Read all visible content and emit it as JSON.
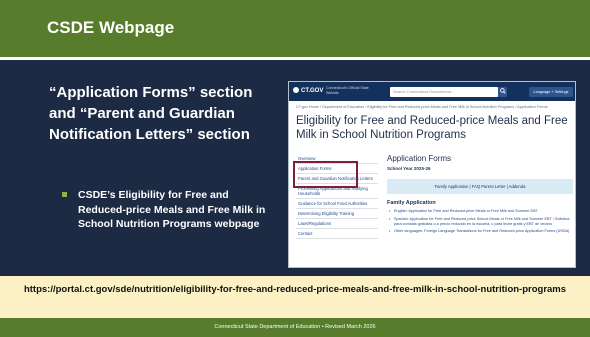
{
  "slide": {
    "title": "CSDE Webpage",
    "heading": "“Application Forms” section and “Parent and Guardian Notification Letters” section",
    "bullet": "CSDE’s Eligibility for Free and Reduced-price Meals and Free Milk in School Nutrition Programs webpage",
    "url": "https://portal.ct.gov/sde/nutrition/eligibility-for-free-and-reduced-price-meals-and-free-milk-in-school-nutrition-programs",
    "footer": "Connecticut State Department of Education • Revised March 2026"
  },
  "colors": {
    "title_bar": "#567c2c",
    "body_panel": "#1c2a44",
    "url_band": "#fbf1c4",
    "highlight_box": "#7b1f3a"
  },
  "screenshot": {
    "logo": "CT.GOV",
    "official": "Connecticut's Official State Website",
    "search_placeholder": "Search Connecticut Government...",
    "search_icon": "search-icon",
    "language_button": "Language + Settings",
    "breadcrumb": "CT.gov Home  /  Department of Education  /  Eligibility for Free and Reduced-price Meals and Free Milk in School Nutrition Programs  /  Application Forms",
    "page_title": "Eligibility for Free and Reduced-price Meals and Free Milk in School Nutrition Programs",
    "nav": [
      "Overview",
      "Application Forms",
      "Parent and Guardian Notification Letters",
      "Processing Applications and Notifying Households",
      "Guidance for School Food Authorities",
      "Determining Eligibility Training",
      "Laws/Regulations",
      "Contact"
    ],
    "section_title": "Application Forms",
    "school_year": "School Year 2025-26",
    "form_links": "Family Application  |  FAQ Parent Letter  |  Addenda",
    "family_heading": "Family Application",
    "family_items": [
      "English: Application for Free and Reduced-price Meals or Free Milk and Summer EBT",
      "Spanish: Application for Free and Reduced-price School Meals or Free Milk and Summer EBT / Solicitud para comidas gratuitas o a precio reducido en la escuela, o para leche gratis y EBT de verano",
      "Other languages: Foreign Language Translations for Free and Reduced-price Application Forms (USDA)"
    ]
  }
}
